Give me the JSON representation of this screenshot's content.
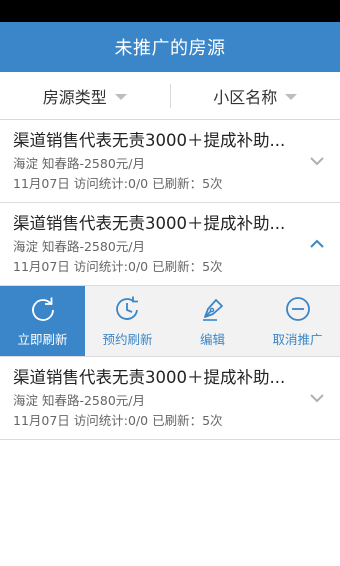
{
  "title": "未推广的房源",
  "filters": [
    {
      "label": "房源类型"
    },
    {
      "label": "小区名称"
    }
  ],
  "listings": [
    {
      "title": "渠道销售代表无责3000＋提成补助...",
      "location": "海淀 知春路-2580元/月",
      "stats": "11月07日 访问统计:0/0 已刷新：5次",
      "expanded": false
    },
    {
      "title": "渠道销售代表无责3000＋提成补助...",
      "location": "海淀 知春路-2580元/月",
      "stats": "11月07日 访问统计:0/0 已刷新：5次",
      "expanded": true
    },
    {
      "title": "渠道销售代表无责3000＋提成补助...",
      "location": "海淀 知春路-2580元/月",
      "stats": "11月07日 访问统计:0/0 已刷新：5次",
      "expanded": false
    }
  ],
  "actions": [
    {
      "label": "立即刷新",
      "icon": "refresh-icon"
    },
    {
      "label": "预约刷新",
      "icon": "scheduled-refresh-icon"
    },
    {
      "label": "编辑",
      "icon": "pen-icon"
    },
    {
      "label": "取消推广",
      "icon": "minus-circle-icon"
    }
  ],
  "colors": {
    "primary": "#3a86c9",
    "statusbar": "#000000",
    "chevron_collapsed": "#b0b0b0",
    "chevron_expanded": "#3a86c9"
  }
}
